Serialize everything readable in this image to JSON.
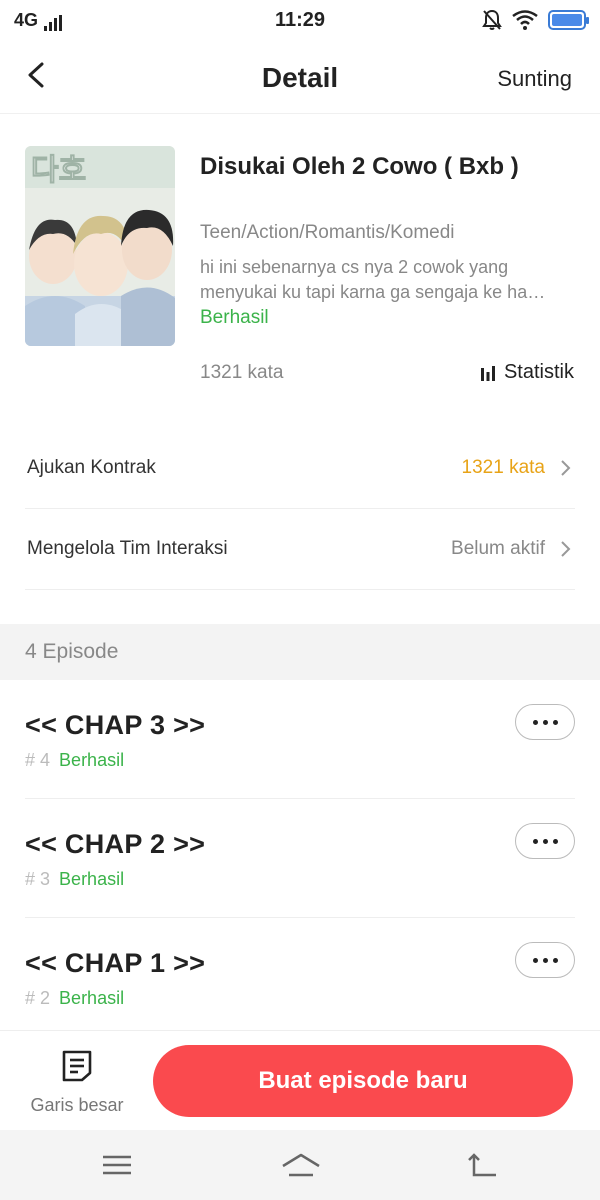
{
  "status_bar": {
    "network": "4G",
    "time": "11:29"
  },
  "header": {
    "title": "Detail",
    "edit_label": "Sunting"
  },
  "book": {
    "title": "Disukai Oleh 2 Cowo ( Bxb )",
    "genre": "Teen/Action/Romantis/Komedi",
    "description": "hi ini sebenarnya cs nya 2 cowok yang menyukai ku tapi karna ga sengaja ke ha…",
    "status": "Berhasil",
    "word_count": "1321 kata",
    "stats_label": "Statistik",
    "cover_text": "다호"
  },
  "rows": [
    {
      "label": "Ajukan Kontrak",
      "value": "1321 kata"
    },
    {
      "label": "Mengelola Tim Interaksi",
      "value": "Belum aktif"
    }
  ],
  "episodes_header": "4 Episode",
  "episodes": [
    {
      "title": "<< CHAP 3 >>",
      "number": "# 4",
      "status": "Berhasil"
    },
    {
      "title": "<< CHAP 2 >>",
      "number": "# 3",
      "status": "Berhasil"
    },
    {
      "title": "<< CHAP 1 >>",
      "number": "# 2",
      "status": "Berhasil"
    }
  ],
  "bottom_bar": {
    "outline_label": "Garis besar",
    "new_episode_label": "Buat episode baru"
  },
  "colors": {
    "accent": "#fa4a4e",
    "success": "#3bb34a",
    "highlight": "#e8a317",
    "muted": "#888888"
  },
  "icons": [
    "signal-icon",
    "mute-icon",
    "wifi-icon",
    "battery-icon",
    "back-icon",
    "stats-icon",
    "chevron-right-icon",
    "more-icon",
    "outline-icon",
    "menu-icon",
    "home-icon",
    "back-nav-icon"
  ]
}
